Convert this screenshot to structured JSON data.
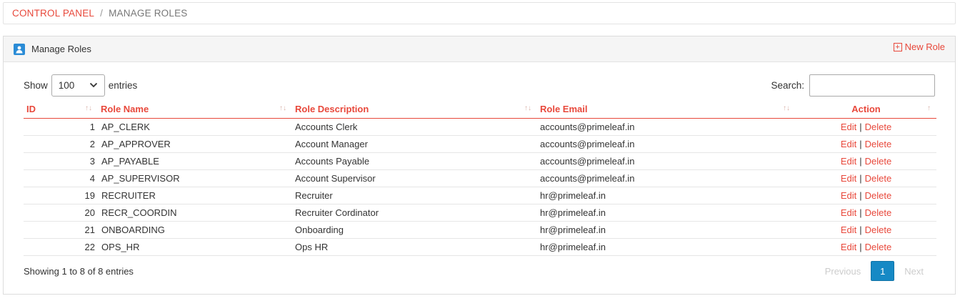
{
  "breadcrumb": {
    "home": "CONTROL PANEL",
    "separator": "/",
    "current": "MANAGE ROLES"
  },
  "panel": {
    "title": "Manage Roles",
    "title_icon": "user-icon",
    "new_role_label": "New Role",
    "new_role_icon": "plus-square-icon"
  },
  "controls": {
    "show_label": "Show",
    "entries_value": "100",
    "entries_label": "entries",
    "search_label": "Search:",
    "search_value": ""
  },
  "table": {
    "headers": {
      "id": "ID",
      "role_name": "Role Name",
      "role_description": "Role Description",
      "role_email": "Role Email",
      "action": "Action"
    },
    "rows": [
      {
        "id": "1",
        "name": "AP_CLERK",
        "description": "Accounts Clerk",
        "email": "accounts@primeleaf.in",
        "edit": "Edit",
        "sep": "|",
        "delete": "Delete"
      },
      {
        "id": "2",
        "name": "AP_APPROVER",
        "description": "Account Manager",
        "email": "accounts@primeleaf.in",
        "edit": "Edit",
        "sep": "|",
        "delete": "Delete"
      },
      {
        "id": "3",
        "name": "AP_PAYABLE",
        "description": "Accounts Payable",
        "email": "accounts@primeleaf.in",
        "edit": "Edit",
        "sep": "|",
        "delete": "Delete"
      },
      {
        "id": "4",
        "name": "AP_SUPERVISOR",
        "description": "Account Supervisor",
        "email": "accounts@primeleaf.in",
        "edit": "Edit",
        "sep": "|",
        "delete": "Delete"
      },
      {
        "id": "19",
        "name": "RECRUITER",
        "description": "Recruiter",
        "email": "hr@primeleaf.in",
        "edit": "Edit",
        "sep": "|",
        "delete": "Delete"
      },
      {
        "id": "20",
        "name": "RECR_COORDIN",
        "description": "Recruiter Cordinator",
        "email": "hr@primeleaf.in",
        "edit": "Edit",
        "sep": "|",
        "delete": "Delete"
      },
      {
        "id": "21",
        "name": "ONBOARDING",
        "description": "Onboarding",
        "email": "hr@primeleaf.in",
        "edit": "Edit",
        "sep": "|",
        "delete": "Delete"
      },
      {
        "id": "22",
        "name": "OPS_HR",
        "description": "Ops HR",
        "email": "hr@primeleaf.in",
        "edit": "Edit",
        "sep": "|",
        "delete": "Delete"
      }
    ]
  },
  "footer": {
    "info": "Showing 1 to 8 of 8 entries",
    "previous": "Previous",
    "current_page": "1",
    "next": "Next"
  },
  "colors": {
    "accent": "#e8483b",
    "page_active": "#1689c5",
    "icon_blue": "#2b8cd6"
  }
}
